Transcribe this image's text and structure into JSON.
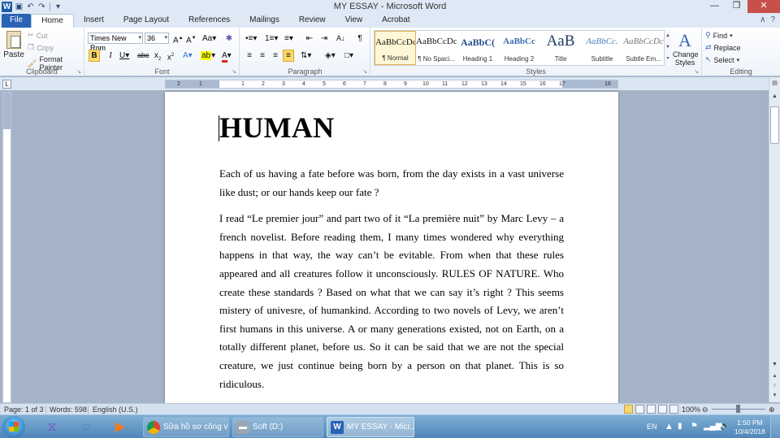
{
  "window": {
    "title": "MY ESSAY - Microsoft Word"
  },
  "tabs": [
    "File",
    "Home",
    "Insert",
    "Page Layout",
    "References",
    "Mailings",
    "Review",
    "View",
    "Acrobat"
  ],
  "clipboard": {
    "paste": "Paste",
    "cut": "Cut",
    "copy": "Copy",
    "format_painter": "Format Painter",
    "group": "Clipboard"
  },
  "font": {
    "name": "Times New Rom",
    "size": "36",
    "group": "Font"
  },
  "paragraph": {
    "group": "Paragraph"
  },
  "styles": {
    "group": "Styles",
    "items": [
      {
        "sample": "AaBbCcDc",
        "name": "¶ Normal"
      },
      {
        "sample": "AaBbCcDc",
        "name": "¶ No Spaci..."
      },
      {
        "sample": "AaBbC(",
        "name": "Heading 1"
      },
      {
        "sample": "AaBbCc",
        "name": "Heading 2"
      },
      {
        "sample": "AaB",
        "name": "Title"
      },
      {
        "sample": "AaBbCc.",
        "name": "Subtitle"
      },
      {
        "sample": "AaBbCcDc",
        "name": "Subtle Em..."
      }
    ],
    "change_styles": "Change Styles"
  },
  "editing": {
    "find": "Find",
    "replace": "Replace",
    "select": "Select",
    "group": "Editing"
  },
  "ruler_numbers": [
    "2",
    "1",
    "1",
    "2",
    "3",
    "4",
    "5",
    "6",
    "7",
    "8",
    "9",
    "10",
    "11",
    "12",
    "13",
    "14",
    "15",
    "16",
    "17",
    "18"
  ],
  "document": {
    "title": "HUMAN",
    "paragraphs": [
      "Each of us having a fate before was born, from the day exists in a vast universe like dust; or our hands keep our fate ?",
      "I read “Le premier jour” and part two of it “La première nuit” by Marc Levy – a french novelist. Before reading them, I many times wondered why everything happens in that way, the way can’t be evitable. From when that these rules appeared and all creatures follow it unconsciously. RULES OF NATURE. Who create these standards ? Based on what that we can say it’s right ? This seems mistery of univesre, of humankind. According to two novels of Levy, we aren’t first humans in this universe. A or many generations existed, not on Earth, on a totally different planet, before us. So it can be said that we are not the special creature, we just continue being born by a person on that planet. This is so ridiculous."
    ]
  },
  "status": {
    "page": "Page: 1 of 3",
    "words": "Words: 598",
    "language": "English (U.S.)",
    "zoom": "100%"
  },
  "taskbar": {
    "tasks": [
      {
        "label": "Sửa hồ sơ công vi...",
        "icon": "chrome-icon"
      },
      {
        "label": "Soft (D:)",
        "icon": "drive-icon"
      },
      {
        "label": "MY ESSAY - Micr...",
        "icon": "word-icon"
      }
    ],
    "lang": "EN",
    "time": "1:50 PM",
    "date": "10/4/2018"
  }
}
